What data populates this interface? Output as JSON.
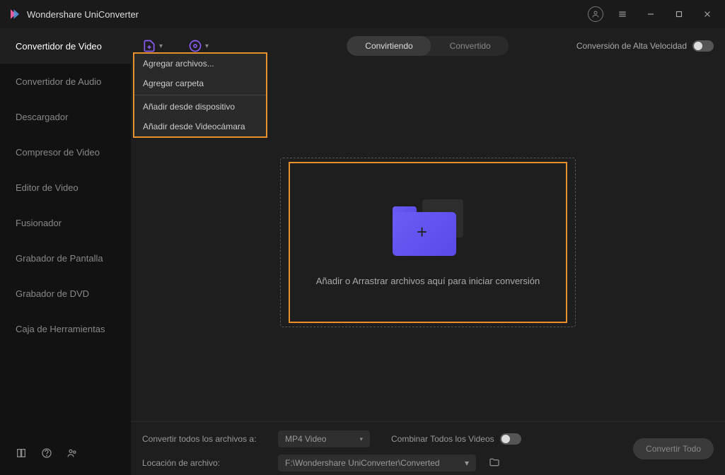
{
  "app": {
    "title": "Wondershare UniConverter"
  },
  "sidebar": {
    "items": [
      {
        "label": "Convertidor de Video"
      },
      {
        "label": "Convertidor de Audio"
      },
      {
        "label": "Descargador"
      },
      {
        "label": "Compresor de Video"
      },
      {
        "label": "Editor de Video"
      },
      {
        "label": "Fusionador"
      },
      {
        "label": "Grabador de Pantalla"
      },
      {
        "label": "Grabador de DVD"
      },
      {
        "label": "Caja de Herramientas"
      }
    ]
  },
  "toolbar": {
    "tabs": {
      "converting": "Convirtiendo",
      "converted": "Convertido"
    },
    "speed_label": "Conversión de Alta Velocidad"
  },
  "dropdown": {
    "add_files": "Agregar archivos...",
    "add_folder": "Agregar carpeta",
    "from_device": "Añadir desde dispositivo",
    "from_camcorder": "Añadir desde Videocámara"
  },
  "dropzone": {
    "text": "Añadir o Arrastrar archivos aquí para iniciar conversión"
  },
  "footer": {
    "convert_all_label": "Convertir todos los archivos a:",
    "format_value": "MP4 Video",
    "combine_label": "Combinar Todos los Videos",
    "location_label": "Locación de archivo:",
    "location_value": "F:\\Wondershare UniConverter\\Converted",
    "convert_button": "Convertir Todo"
  }
}
